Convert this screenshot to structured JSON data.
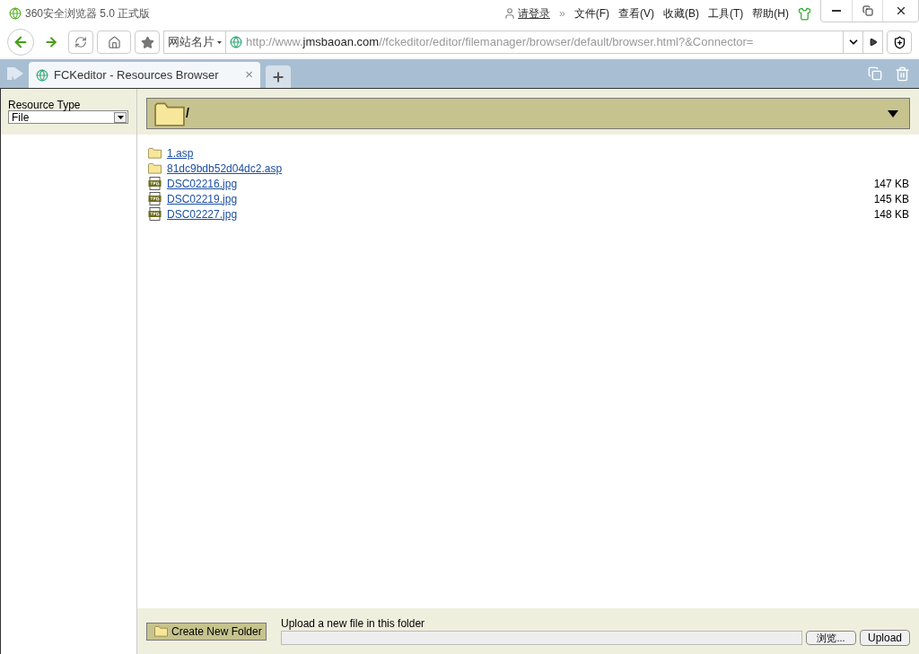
{
  "window": {
    "title": "360安全浏览器 5.0 正式版",
    "login": "请登录",
    "chevron": "»",
    "menu": [
      "文件(F)",
      "查看(V)",
      "收藏(B)",
      "工具(T)",
      "帮助(H)"
    ]
  },
  "address_bar": {
    "site_cards": "网站名片",
    "url_light": "http://www.",
    "url_host": "jmsbaoan.com",
    "url_path": "//fckeditor/editor/filemanager/browser/default/browser.html?&Connector="
  },
  "tabs": [
    {
      "label": "FCKeditor - Resources Browser",
      "selected": true,
      "close": "×"
    }
  ],
  "resource_type": {
    "label": "Resource Type",
    "value": "File"
  },
  "current_folder": "/",
  "files": [
    {
      "kind": "folder",
      "name": "1.asp"
    },
    {
      "kind": "folder",
      "name": "81dc9bdb52d04dc2.asp"
    },
    {
      "kind": "image",
      "name": "DSC02216.jpg",
      "size": "147 KB"
    },
    {
      "kind": "image",
      "name": "DSC02219.jpg",
      "size": "145 KB"
    },
    {
      "kind": "image",
      "name": "DSC02227.jpg",
      "size": "148 KB"
    }
  ],
  "create_folder_button": "Create New Folder",
  "upload": {
    "label": "Upload a new file in this folder",
    "browse_button": "浏览...",
    "upload_button": "Upload"
  }
}
